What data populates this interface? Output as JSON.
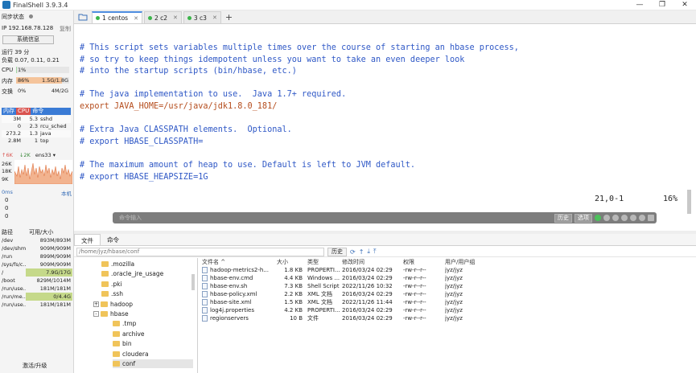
{
  "window": {
    "title": "FinalShell 3.9.3.4",
    "controls": [
      "—",
      "❐",
      "✕"
    ]
  },
  "sidebar": {
    "sync_status": "同步状态",
    "ip_label": "IP 192.168.78.128",
    "copy": "复制",
    "sysinfo_button": "系统信息",
    "uptime": "运行 39 分",
    "load": "负载 0.07, 0.11, 0.21",
    "cpu_label": "CPU",
    "cpu_value": "1%",
    "cpu_pct": 0.01,
    "mem_label": "内存",
    "mem_pct_text": "86%",
    "mem_value": "1.5G/1.8G",
    "mem_pct": 0.86,
    "swap_label": "交换",
    "swap_pct_text": "0%",
    "swap_value": "4M/2G",
    "proc_head": [
      "内存",
      "CPU",
      "命令"
    ],
    "processes": [
      {
        "mem": "3M",
        "cpu": "5.3",
        "cmd": "sshd"
      },
      {
        "mem": "0",
        "cpu": "2.3",
        "cmd": "rcu_sched"
      },
      {
        "mem": "273.2",
        "cpu": "1.3",
        "cmd": "java"
      },
      {
        "mem": "2.8M",
        "cpu": "1",
        "cmd": "top"
      }
    ],
    "net_up": "↑6K",
    "net_down": "↓2K",
    "net_iface": "ens33 ▾",
    "net_scale": [
      "26K",
      "18K",
      "9K"
    ],
    "latency": "0ms",
    "local_label": "本机",
    "latency_vals": [
      "0",
      "0",
      "0"
    ],
    "disk_head": [
      "路径",
      "可用/大小"
    ],
    "disks": [
      {
        "path": "/dev",
        "size": "893M/893M",
        "hl": false
      },
      {
        "path": "/dev/shm",
        "size": "909M/909M",
        "hl": false
      },
      {
        "path": "/run",
        "size": "899M/909M",
        "hl": false
      },
      {
        "path": "/sys/fs/c...",
        "size": "909M/909M",
        "hl": false
      },
      {
        "path": "/",
        "size": "7.9G/17G",
        "hl": true
      },
      {
        "path": "/boot",
        "size": "829M/1014M",
        "hl": false
      },
      {
        "path": "/run/use...",
        "size": "181M/181M",
        "hl": false
      },
      {
        "path": "/run/me...",
        "size": "0/4.4G",
        "hl": true
      },
      {
        "path": "/run/use...",
        "size": "181M/181M",
        "hl": false
      }
    ],
    "upgrade": "激活/升级"
  },
  "tabs": [
    {
      "label": "1 centos",
      "active": true
    },
    {
      "label": "2 c2",
      "active": false
    },
    {
      "label": "3 c3",
      "active": false
    }
  ],
  "terminal": {
    "lines": [
      {
        "cls": "c",
        "text": "# This script sets variables multiple times over the course of starting an hbase process,"
      },
      {
        "cls": "c",
        "text": "# so try to keep things idempotent unless you want to take an even deeper look"
      },
      {
        "cls": "c",
        "text": "# into the startup scripts (bin/hbase, etc.)"
      },
      {
        "cls": "plain",
        "text": ""
      },
      {
        "cls": "c",
        "text": "# The java implementation to use.  Java 1.7+ required."
      },
      {
        "cls": "e",
        "text": "export JAVA_HOME=/usr/java/jdk1.8.0_181/"
      },
      {
        "cls": "plain",
        "text": ""
      },
      {
        "cls": "c",
        "text": "# Extra Java CLASSPATH elements.  Optional."
      },
      {
        "cls": "c",
        "text": "# export HBASE_CLASSPATH="
      },
      {
        "cls": "plain",
        "text": ""
      },
      {
        "cls": "c",
        "text": "# The maximum amount of heap to use. Default is left to JVM default."
      },
      {
        "cls": "c",
        "text": "# export HBASE_HEAPSIZE=1G"
      }
    ],
    "cursor_pos": "21,0-1",
    "percent": "16%",
    "cmd_placeholder": "命令输入",
    "history_btn": "历史",
    "options_btn": "选项"
  },
  "bottom": {
    "tabs": [
      "文件",
      "命令"
    ],
    "path": "/home/jyz/hbase/conf",
    "history": "历史",
    "tree": [
      {
        "label": ".mozilla",
        "indent": 1,
        "toggle": ""
      },
      {
        "label": ".oracle_jre_usage",
        "indent": 1,
        "toggle": ""
      },
      {
        "label": ".pki",
        "indent": 1,
        "toggle": ""
      },
      {
        "label": ".ssh",
        "indent": 1,
        "toggle": ""
      },
      {
        "label": "hadoop",
        "indent": 1,
        "toggle": "+"
      },
      {
        "label": "hbase",
        "indent": 1,
        "toggle": "-"
      },
      {
        "label": ".tmp",
        "indent": 2,
        "toggle": ""
      },
      {
        "label": "archive",
        "indent": 2,
        "toggle": ""
      },
      {
        "label": "bin",
        "indent": 2,
        "toggle": ""
      },
      {
        "label": "cloudera",
        "indent": 2,
        "toggle": ""
      },
      {
        "label": "conf",
        "indent": 2,
        "toggle": "",
        "selected": true
      }
    ],
    "columns": [
      "文件名 ^",
      "大小",
      "类型",
      "修改时间",
      "权限",
      "用户/用户组"
    ],
    "files": [
      {
        "name": "hadoop-metrics2-h...",
        "size": "1.8 KB",
        "type": "PROPERTI...",
        "date": "2016/03/24 02:29",
        "perm": "-rw-r--r--",
        "user": "jyz/jyz"
      },
      {
        "name": "hbase-env.cmd",
        "size": "4.4 KB",
        "type": "Windows ...",
        "date": "2016/03/24 02:29",
        "perm": "-rw-r--r--",
        "user": "jyz/jyz"
      },
      {
        "name": "hbase-env.sh",
        "size": "7.3 KB",
        "type": "Shell Script",
        "date": "2022/11/26 10:32",
        "perm": "-rw-r--r--",
        "user": "jyz/jyz"
      },
      {
        "name": "hbase-policy.xml",
        "size": "2.2 KB",
        "type": "XML 文档",
        "date": "2016/03/24 02:29",
        "perm": "-rw-r--r--",
        "user": "jyz/jyz"
      },
      {
        "name": "hbase-site.xml",
        "size": "1.5 KB",
        "type": "XML 文档",
        "date": "2022/11/26 11:44",
        "perm": "-rw-r--r--",
        "user": "jyz/jyz"
      },
      {
        "name": "log4j.properties",
        "size": "4.2 KB",
        "type": "PROPERTI...",
        "date": "2016/03/24 02:29",
        "perm": "-rw-r--r--",
        "user": "jyz/jyz"
      },
      {
        "name": "regionservers",
        "size": "10 B",
        "type": "文件",
        "date": "2016/03/24 02:29",
        "perm": "-rw-r--r--",
        "user": "jyz/jyz"
      }
    ]
  }
}
